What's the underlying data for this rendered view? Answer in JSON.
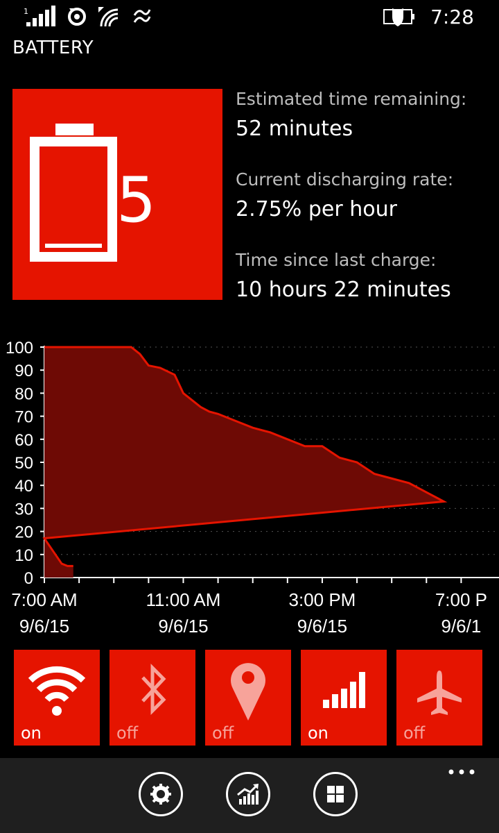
{
  "status_bar": {
    "signal_icon": "signal-bars-icon",
    "sim_label": "1",
    "icons": [
      "signal-bars-icon",
      "sync-icon",
      "wifi-icon",
      "data-transfer-icon",
      "battery-saver-icon"
    ],
    "time": "7:28"
  },
  "page": {
    "title": "BATTERY"
  },
  "battery": {
    "level": "5",
    "icon": "battery-icon",
    "accent": "#e51400"
  },
  "stats": [
    {
      "label": "Estimated time remaining:",
      "value": "52 minutes"
    },
    {
      "label": "Current discharging rate:",
      "value": "2.75% per hour"
    },
    {
      "label": "Time since last charge:",
      "value": "10 hours 22 minutes"
    }
  ],
  "chart_data": {
    "type": "area",
    "x": [
      "7:00",
      "7:30",
      "8:00",
      "8:30",
      "9:00",
      "9:30",
      "9:45",
      "10:00",
      "10:20",
      "10:45",
      "11:00",
      "11:30",
      "11:45",
      "12:00",
      "12:30",
      "1:00",
      "1:30",
      "2:00",
      "2:30",
      "3:00",
      "3:30",
      "4:00",
      "4:30",
      "5:00",
      "5:30",
      "6:00",
      "6:30",
      "7:00",
      "7:30",
      "7:40",
      "7:50"
    ],
    "y": [
      100,
      100,
      100,
      100,
      100,
      100,
      97,
      92,
      91,
      88,
      80,
      74,
      72,
      71,
      68,
      65,
      63,
      60,
      57,
      57,
      52,
      50,
      45,
      43,
      41,
      37,
      33,
      17,
      6,
      5,
      5
    ],
    "ylim": [
      0,
      100
    ],
    "yticks": [
      "100",
      "90",
      "80",
      "70",
      "60",
      "50",
      "40",
      "30",
      "20",
      "10",
      "0"
    ],
    "xticks": [
      {
        "time": "7:00 AM",
        "date": "9/6/15"
      },
      {
        "time": "11:00 AM",
        "date": "9/6/15"
      },
      {
        "time": "3:00 PM",
        "date": "9/6/15"
      },
      {
        "time": "7:00 P",
        "date": "9/6/1"
      }
    ],
    "grid": true,
    "line_color": "#e51400",
    "fill_color": "#6e0a05"
  },
  "toggles": [
    {
      "name": "wifi",
      "icon": "wifi-icon",
      "state": "on"
    },
    {
      "name": "bluetooth",
      "icon": "bluetooth-icon",
      "state": "off"
    },
    {
      "name": "location",
      "icon": "location-pin-icon",
      "state": "off"
    },
    {
      "name": "cellular",
      "icon": "cellular-signal-icon",
      "state": "on"
    },
    {
      "name": "airplane",
      "icon": "airplane-icon",
      "state": "off"
    }
  ],
  "app_bar": {
    "buttons": [
      "gear-icon",
      "chart-icon",
      "tiles-icon"
    ],
    "more": "ellipsis-icon"
  }
}
